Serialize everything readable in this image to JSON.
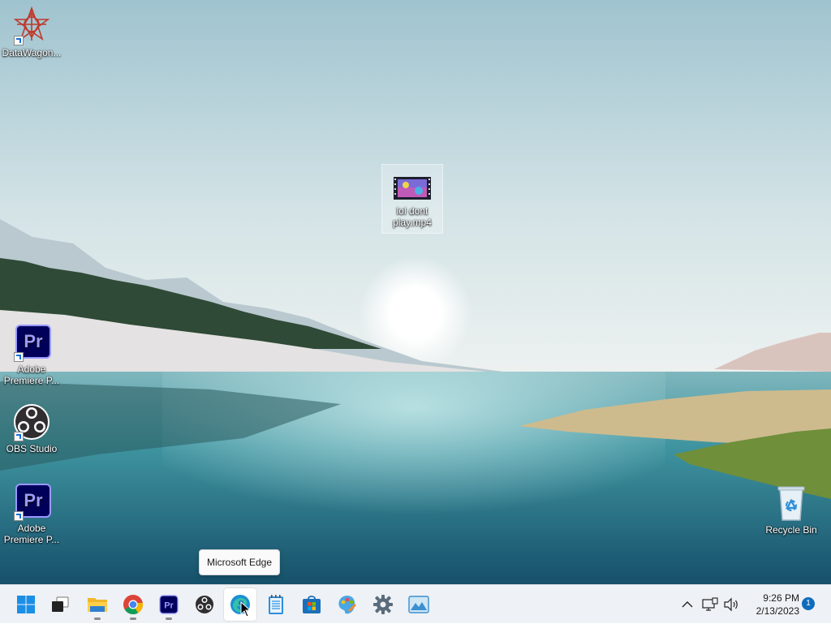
{
  "desktop": {
    "icons": [
      {
        "label": "DataWagon...",
        "icon": "datawagon-star-icon"
      },
      {
        "label": "lol dont play.mp4",
        "icon": "video-file-icon"
      },
      {
        "label": "Adobe Premiere P...",
        "icon": "premiere-pro-icon",
        "badge": "Pr"
      },
      {
        "label": "OBS Studio",
        "icon": "obs-studio-icon"
      },
      {
        "label": "Adobe Premiere P...",
        "icon": "premiere-pro-icon",
        "badge": "Pr"
      },
      {
        "label": "Recycle Bin",
        "icon": "recycle-bin-icon"
      }
    ]
  },
  "tooltip": {
    "text": "Microsoft Edge"
  },
  "taskbar": {
    "apps": [
      {
        "name": "Start",
        "icon": "windows-start-icon"
      },
      {
        "name": "Task View",
        "icon": "task-view-icon"
      },
      {
        "name": "File Explorer",
        "icon": "file-explorer-icon",
        "running": true
      },
      {
        "name": "Google Chrome",
        "icon": "chrome-icon",
        "running": true
      },
      {
        "name": "Adobe Premiere Pro",
        "icon": "premiere-pro-icon",
        "running": true
      },
      {
        "name": "OBS Studio",
        "icon": "obs-studio-icon"
      },
      {
        "name": "Microsoft Edge",
        "icon": "edge-icon",
        "hovered": true
      },
      {
        "name": "Notepad",
        "icon": "notepad-icon"
      },
      {
        "name": "Microsoft Store",
        "icon": "store-icon"
      },
      {
        "name": "Paint",
        "icon": "paint-palette-icon"
      },
      {
        "name": "Settings",
        "icon": "settings-gear-icon"
      },
      {
        "name": "Photo viewer",
        "icon": "photos-icon"
      }
    ],
    "tray": {
      "time": "9:26 PM",
      "date": "2/13/2023",
      "notifications": "1"
    }
  },
  "colors": {
    "sky_top": "#a9cbd6",
    "sky_bottom": "#e6eef0",
    "water": "#3b8f9c",
    "taskbar": "#eef1f5",
    "accent": "#0f6cbd"
  }
}
